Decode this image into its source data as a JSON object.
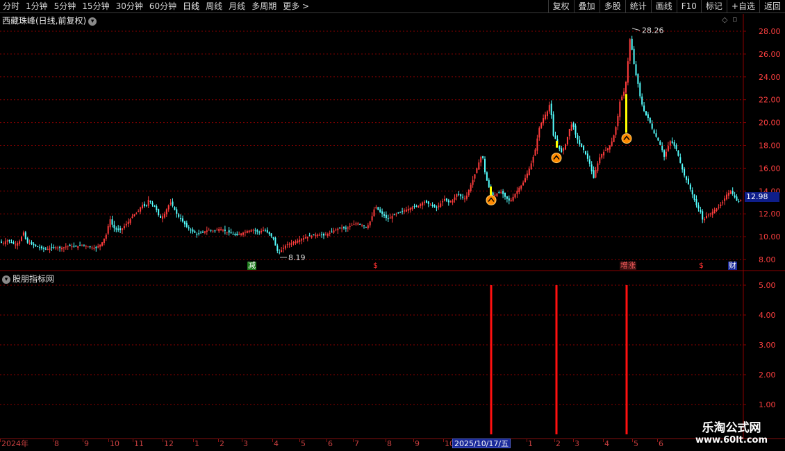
{
  "toolbar": {
    "periods": [
      "分时",
      "1分钟",
      "5分钟",
      "15分钟",
      "30分钟",
      "60分钟",
      "日线",
      "周线",
      "月线",
      "多周期",
      "更多"
    ],
    "more_arrow": ">",
    "right_buttons": [
      "复权",
      "叠加",
      "多股",
      "统计",
      "画线",
      "F10",
      "标记",
      "+自选",
      "返回"
    ]
  },
  "stock": {
    "title": "西藏珠峰(日线,前复权)",
    "current_price": "12.98",
    "high_label": "28.26",
    "low_label": "8.19"
  },
  "indicator": {
    "title": "股朋指标网"
  },
  "markers": {
    "jian": "减",
    "s1": "$",
    "hua_zhang": "增涨",
    "s2": "$",
    "cai": "财"
  },
  "date_axis": {
    "labels": [
      "2024年",
      "8",
      "9",
      "10",
      "11",
      "12",
      "1",
      "2",
      "3",
      "4",
      "5",
      "6",
      "7",
      "8",
      "9",
      "10",
      "1",
      "2",
      "3",
      "4",
      "5",
      "6"
    ],
    "cursor": "2025/10/17/五"
  },
  "watermark": {
    "line1": "乐淘公式网",
    "line2": "www.60lt.com"
  },
  "colors": {
    "up": "#ff3c3c",
    "down": "#54ffff",
    "grid": "#8b0000",
    "axis_text": "#ff4040",
    "signal_bar": "#ff1010",
    "signal_icon": "#ff8a00",
    "yellow_bar": "#ffff00"
  },
  "chart_data": [
    {
      "type": "candlestick",
      "ylim": [
        7.5,
        29
      ],
      "y_ticks": [
        "28.00",
        "26.00",
        "24.00",
        "22.00",
        "20.00",
        "18.00",
        "16.00",
        "14.00",
        "12.00",
        "10.00",
        "8.00"
      ],
      "y_tick_values": [
        28,
        26,
        24,
        22,
        20,
        18,
        16,
        14,
        12,
        10,
        8
      ],
      "close_path": [
        [
          0,
          9.6
        ],
        [
          6,
          9.4
        ],
        [
          12,
          9.7
        ],
        [
          18,
          9.5
        ],
        [
          24,
          9.3
        ],
        [
          30,
          9.6
        ],
        [
          36,
          10.4
        ],
        [
          40,
          9.5
        ],
        [
          46,
          9.4
        ],
        [
          52,
          9.2
        ],
        [
          60,
          9.0
        ],
        [
          70,
          8.9
        ],
        [
          80,
          9.1
        ],
        [
          90,
          9.0
        ],
        [
          100,
          9.2
        ],
        [
          110,
          9.1
        ],
        [
          120,
          9.3
        ],
        [
          130,
          9.1
        ],
        [
          140,
          9.0
        ],
        [
          148,
          9.4
        ],
        [
          155,
          10.2
        ],
        [
          160,
          11.6
        ],
        [
          165,
          10.8
        ],
        [
          170,
          10.6
        ],
        [
          176,
          10.6
        ],
        [
          182,
          11.0
        ],
        [
          188,
          11.4
        ],
        [
          194,
          11.9
        ],
        [
          200,
          12.1
        ],
        [
          206,
          12.8
        ],
        [
          212,
          12.6
        ],
        [
          216,
          13.3
        ],
        [
          220,
          12.9
        ],
        [
          226,
          12.5
        ],
        [
          232,
          11.6
        ],
        [
          238,
          11.9
        ],
        [
          244,
          12.7
        ],
        [
          248,
          13.0
        ],
        [
          252,
          12.5
        ],
        [
          258,
          11.8
        ],
        [
          264,
          11.4
        ],
        [
          270,
          10.9
        ],
        [
          278,
          10.5
        ],
        [
          286,
          10.2
        ],
        [
          294,
          10.4
        ],
        [
          302,
          10.6
        ],
        [
          310,
          10.5
        ],
        [
          318,
          10.7
        ],
        [
          326,
          10.5
        ],
        [
          334,
          10.3
        ],
        [
          342,
          10.1
        ],
        [
          350,
          10.3
        ],
        [
          358,
          10.5
        ],
        [
          366,
          10.6
        ],
        [
          374,
          10.4
        ],
        [
          382,
          10.6
        ],
        [
          390,
          10.2
        ],
        [
          396,
          9.8
        ],
        [
          400,
          8.8
        ],
        [
          404,
          8.6
        ],
        [
          408,
          8.9
        ],
        [
          414,
          9.3
        ],
        [
          420,
          9.4
        ],
        [
          428,
          9.6
        ],
        [
          436,
          9.8
        ],
        [
          444,
          10.0
        ],
        [
          452,
          10.1
        ],
        [
          460,
          10.2
        ],
        [
          468,
          10.1
        ],
        [
          476,
          10.3
        ],
        [
          484,
          10.6
        ],
        [
          492,
          10.8
        ],
        [
          500,
          10.7
        ],
        [
          508,
          11.0
        ],
        [
          516,
          11.2
        ],
        [
          524,
          11.0
        ],
        [
          530,
          10.8
        ],
        [
          536,
          11.5
        ],
        [
          542,
          12.7
        ],
        [
          548,
          12.2
        ],
        [
          554,
          11.9
        ],
        [
          560,
          11.5
        ],
        [
          566,
          11.8
        ],
        [
          572,
          12.0
        ],
        [
          580,
          12.2
        ],
        [
          588,
          12.4
        ],
        [
          596,
          12.6
        ],
        [
          604,
          12.7
        ],
        [
          612,
          13.1
        ],
        [
          618,
          12.9
        ],
        [
          624,
          12.7
        ],
        [
          630,
          12.5
        ],
        [
          636,
          12.9
        ],
        [
          642,
          13.3
        ],
        [
          648,
          13.0
        ],
        [
          654,
          13.2
        ],
        [
          660,
          13.8
        ],
        [
          666,
          13.5
        ],
        [
          672,
          13.3
        ],
        [
          678,
          14.3
        ],
        [
          684,
          15.2
        ],
        [
          690,
          16.3
        ],
        [
          696,
          17.3
        ],
        [
          700,
          15.6
        ],
        [
          704,
          14.6
        ],
        [
          708,
          14.0
        ],
        [
          712,
          13.6
        ],
        [
          718,
          13.8
        ],
        [
          724,
          13.9
        ],
        [
          730,
          13.4
        ],
        [
          736,
          13.1
        ],
        [
          742,
          13.6
        ],
        [
          748,
          14.2
        ],
        [
          754,
          14.6
        ],
        [
          760,
          15.4
        ],
        [
          766,
          16.3
        ],
        [
          772,
          17.5
        ],
        [
          778,
          19.5
        ],
        [
          784,
          20.4
        ],
        [
          790,
          21.0
        ],
        [
          794,
          21.8
        ],
        [
          798,
          18.9
        ],
        [
          802,
          18.5
        ],
        [
          806,
          17.8
        ],
        [
          810,
          17.4
        ],
        [
          816,
          18.1
        ],
        [
          822,
          19.5
        ],
        [
          826,
          20.0
        ],
        [
          830,
          19.0
        ],
        [
          836,
          18.1
        ],
        [
          842,
          17.6
        ],
        [
          848,
          16.8
        ],
        [
          852,
          16.2
        ],
        [
          856,
          15.0
        ],
        [
          860,
          16.0
        ],
        [
          866,
          17.1
        ],
        [
          872,
          17.5
        ],
        [
          878,
          17.8
        ],
        [
          884,
          18.5
        ],
        [
          890,
          20.0
        ],
        [
          894,
          21.8
        ],
        [
          898,
          22.4
        ],
        [
          902,
          23.0
        ],
        [
          906,
          25.5
        ],
        [
          909,
          27.5
        ],
        [
          912,
          26.2
        ],
        [
          916,
          24.5
        ],
        [
          920,
          23.5
        ],
        [
          924,
          22.0
        ],
        [
          930,
          20.8
        ],
        [
          936,
          20.3
        ],
        [
          942,
          19.2
        ],
        [
          948,
          18.6
        ],
        [
          954,
          17.8
        ],
        [
          958,
          17.0
        ],
        [
          962,
          17.6
        ],
        [
          966,
          18.4
        ],
        [
          970,
          18.2
        ],
        [
          976,
          17.6
        ],
        [
          980,
          16.7
        ],
        [
          986,
          15.5
        ],
        [
          992,
          14.7
        ],
        [
          998,
          13.8
        ],
        [
          1004,
          12.8
        ],
        [
          1010,
          12.2
        ],
        [
          1014,
          11.3
        ],
        [
          1018,
          11.8
        ],
        [
          1024,
          12.0
        ],
        [
          1030,
          12.3
        ],
        [
          1036,
          12.6
        ],
        [
          1042,
          13.0
        ],
        [
          1048,
          13.7
        ],
        [
          1054,
          14.0
        ],
        [
          1060,
          13.4
        ],
        [
          1064,
          13.0
        ],
        [
          1068,
          13.2
        ]
      ]
    },
    {
      "type": "bar",
      "y_ticks": [
        "5.00",
        "4.00",
        "3.00",
        "2.00",
        "1.00"
      ],
      "y_tick_values": [
        5,
        4,
        3,
        2,
        1
      ],
      "ylim": [
        0,
        5.6
      ],
      "signals": [
        {
          "index": 707,
          "value": 5
        },
        {
          "index": 801,
          "value": 5
        },
        {
          "index": 902,
          "value": 5
        }
      ]
    }
  ]
}
